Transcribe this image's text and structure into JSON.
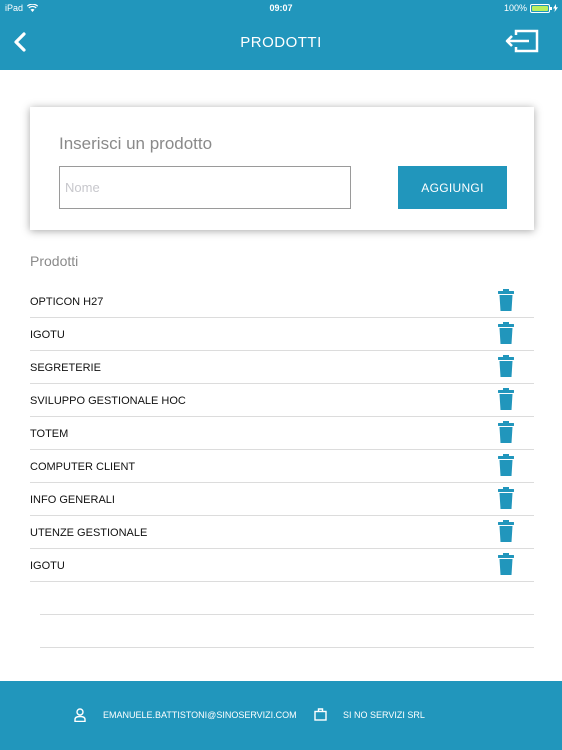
{
  "status_bar": {
    "carrier": "iPad",
    "time": "09:07",
    "battery": "100%",
    "battery_level": 1.0
  },
  "header": {
    "title": "PRODOTTI",
    "back_icon": "chevron-left-icon",
    "logout_icon": "logout-icon"
  },
  "add_card": {
    "title": "Inserisci un prodotto",
    "input_placeholder": "Nome",
    "input_value": "",
    "button_label": "AGGIUNGI"
  },
  "list_section": {
    "label": "Prodotti",
    "items": [
      {
        "label": "OPTICON H27"
      },
      {
        "label": "IGOTU"
      },
      {
        "label": "SEGRETERIE"
      },
      {
        "label": "SVILUPPO GESTIONALE HOC"
      },
      {
        "label": "TOTEM"
      },
      {
        "label": "COMPUTER CLIENT"
      },
      {
        "label": "INFO GENERALI"
      },
      {
        "label": "UTENZE GESTIONALE"
      },
      {
        "label": "IGOTU"
      }
    ]
  },
  "footer": {
    "email": "EMANUELE.BATTISTONI@SINOSERVIZI.COM",
    "company": "SI NO SERVIZI SRL"
  },
  "colors": {
    "accent": "#2196bc",
    "trash": "#2196bc"
  }
}
